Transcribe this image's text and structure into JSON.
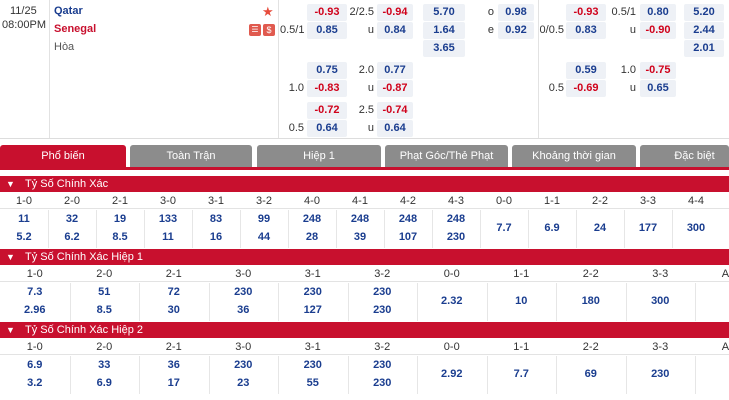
{
  "match": {
    "date": "11/25",
    "time": "08:00PM",
    "home": "Qatar",
    "away": "Senegal",
    "draw": "Hòa",
    "star_color": "#e74c3c"
  },
  "odds_full": {
    "rows": [
      {
        "hcap_label": "",
        "hcap_home": "-0.93",
        "ou_label": "2/2.5",
        "ou_over": "-0.94",
        "x12": "5.70"
      },
      {
        "hcap_label": "0.5/1",
        "hcap_home": "0.85",
        "ou_label": "u",
        "ou_over": "0.84",
        "x12": "1.64"
      },
      {
        "hcap_label": "",
        "hcap_home": "",
        "ou_label": "",
        "ou_over": "",
        "x12": "3.65"
      }
    ],
    "extra1": [
      {
        "hcap_label": "",
        "hcap_home": "0.75",
        "ou_label": "2.0",
        "ou_over": "0.77"
      },
      {
        "hcap_label": "1.0",
        "hcap_home": "-0.83",
        "ou_label": "u",
        "ou_over": "-0.87"
      }
    ],
    "extra2": [
      {
        "hcap_label": "",
        "hcap_home": "-0.72",
        "ou_label": "2.5",
        "ou_over": "-0.74"
      },
      {
        "hcap_label": "0.5",
        "hcap_home": "0.64",
        "ou_label": "u",
        "ou_over": "0.64"
      }
    ],
    "oe": [
      {
        "label": "o",
        "value": "0.98"
      },
      {
        "label": "e",
        "value": "0.92"
      }
    ]
  },
  "odds_half": {
    "rows": [
      {
        "hcap_label": "",
        "hcap_home": "-0.93",
        "ou_label": "0.5/1",
        "ou_over": "0.80",
        "x12": "5.20"
      },
      {
        "hcap_label": "0/0.5",
        "hcap_home": "0.83",
        "ou_label": "u",
        "ou_over": "-0.90",
        "x12": "2.44"
      },
      {
        "hcap_label": "",
        "hcap_home": "",
        "ou_label": "",
        "ou_over": "",
        "x12": "2.01"
      }
    ],
    "extra1": [
      {
        "hcap_label": "",
        "hcap_home": "0.59",
        "ou_label": "1.0",
        "ou_over": "-0.75"
      },
      {
        "hcap_label": "0.5",
        "hcap_home": "-0.69",
        "ou_label": "u",
        "ou_over": "0.65"
      }
    ]
  },
  "tabs": [
    "Phổ biến",
    "Toàn Trận",
    "Hiệp 1",
    "Phạt Góc/Thẻ Phạt",
    "Khoảng thời gian",
    "Đặc biệt"
  ],
  "sections": [
    {
      "title": "Tỷ Số Chính Xác",
      "headers": [
        "1-0",
        "2-0",
        "2-1",
        "3-0",
        "3-1",
        "3-2",
        "4-0",
        "4-1",
        "4-2",
        "4-3",
        "0-0",
        "1-1",
        "2-2",
        "3-3",
        "4-4"
      ],
      "row1": [
        "11",
        "32",
        "19",
        "133",
        "83",
        "99",
        "248",
        "248",
        "248",
        "248",
        "7.7",
        "6.9",
        "24",
        "177",
        "300"
      ],
      "row2": [
        "5.2",
        "6.2",
        "8.5",
        "11",
        "16",
        "44",
        "28",
        "39",
        "107",
        "230",
        "",
        "",
        "",
        "",
        ""
      ]
    },
    {
      "title": "Tỷ Số Chính Xác Hiệp 1",
      "headers": [
        "1-0",
        "2-0",
        "2-1",
        "3-0",
        "3-1",
        "3-2",
        "0-0",
        "1-1",
        "2-2",
        "3-3",
        "AO"
      ],
      "row1": [
        "7.3",
        "51",
        "72",
        "230",
        "230",
        "230",
        "2.32",
        "10",
        "180",
        "300",
        ""
      ],
      "row2": [
        "2.96",
        "8.5",
        "30",
        "36",
        "127",
        "230",
        "",
        "",
        "",
        "",
        ""
      ]
    },
    {
      "title": "Tỷ Số Chính Xác Hiệp 2",
      "headers": [
        "1-0",
        "2-0",
        "2-1",
        "3-0",
        "3-1",
        "3-2",
        "0-0",
        "1-1",
        "2-2",
        "3-3",
        "AO"
      ],
      "row1": [
        "6.9",
        "33",
        "36",
        "230",
        "230",
        "230",
        "2.92",
        "7.7",
        "69",
        "230",
        ""
      ],
      "row2": [
        "3.2",
        "6.9",
        "17",
        "23",
        "55",
        "230",
        "",
        "",
        "",
        "",
        ""
      ]
    }
  ]
}
